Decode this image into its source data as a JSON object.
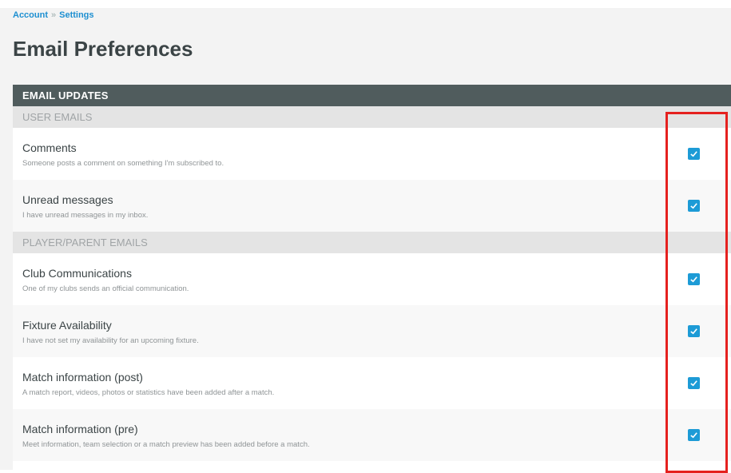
{
  "breadcrumb": {
    "items": [
      "Account",
      "Settings"
    ],
    "separator": "»"
  },
  "page_title": "Email Preferences",
  "panel": {
    "title": "EMAIL UPDATES",
    "sections": [
      {
        "label": "USER EMAILS",
        "items": [
          {
            "title": "Comments",
            "description": "Someone posts a comment on something I'm subscribed to.",
            "checked": true
          },
          {
            "title": "Unread messages",
            "description": "I have unread messages in my inbox.",
            "checked": true
          }
        ]
      },
      {
        "label": "PLAYER/PARENT EMAILS",
        "items": [
          {
            "title": "Club Communications",
            "description": "One of my clubs sends an official communication.",
            "checked": true
          },
          {
            "title": "Fixture Availability",
            "description": "I have not set my availability for an upcoming fixture.",
            "checked": true
          },
          {
            "title": "Match information (post)",
            "description": "A match report, videos, photos or statistics have been added after a match.",
            "checked": true
          },
          {
            "title": "Match information (pre)",
            "description": "Meet information, team selection or a match preview has been added before a match.",
            "checked": true
          }
        ]
      }
    ]
  },
  "colors": {
    "accent": "#1d9bd6",
    "panel_header": "#505c5d",
    "section_header": "#e4e4e4",
    "highlight": "#e5211f"
  },
  "icons": {
    "checkbox": "check-icon"
  }
}
